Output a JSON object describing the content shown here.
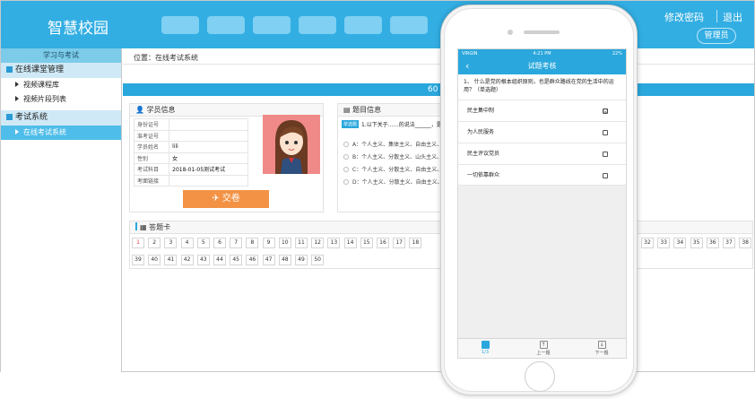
{
  "header": {
    "logo": "智慧校园",
    "change_password": "修改密码",
    "logout": "退出",
    "admin": "管理员"
  },
  "sidebar": {
    "title": "学习与考试",
    "groups": [
      {
        "label": "在线课堂管理",
        "items": [
          {
            "label": "视频课程库"
          },
          {
            "label": "视频片段列表"
          }
        ]
      },
      {
        "label": "考试系统",
        "items": [
          {
            "label": "在线考试系统"
          }
        ]
      }
    ]
  },
  "main": {
    "breadcrumb": "位置：在线考试系统",
    "timer_text": "60 :",
    "student_panel": {
      "title": "学员信息",
      "rows": [
        {
          "label": "身份证号",
          "value": ""
        },
        {
          "label": "准考证号",
          "value": ""
        },
        {
          "label": "学员姓名",
          "value": "lili"
        },
        {
          "label": "性别",
          "value": "女"
        },
        {
          "label": "考试科目",
          "value": "2018-01-05测试考试"
        },
        {
          "label": "考面链接",
          "value": ""
        }
      ],
      "submit_label": "交卷"
    },
    "question_panel": {
      "title": "题目信息",
      "tag": "单选题",
      "question": "1.以下关于……的说法______，是",
      "options": [
        {
          "label": "A：个人主义、集体主义、自由主义、..."
        },
        {
          "label": "B：个人主义、分散主义、山头主义、..."
        },
        {
          "label": "C：个人主义、分散主义、自由主义、..."
        },
        {
          "label": "D：个人主义、分散主义、自由主义、..."
        }
      ]
    },
    "answer_card": {
      "title": "答题卡",
      "row1": [
        "1",
        "2",
        "3",
        "4",
        "5",
        "6",
        "7",
        "8",
        "9",
        "10",
        "11",
        "12",
        "13",
        "14",
        "15",
        "16",
        "17",
        "18"
      ],
      "row1_right": [
        "32",
        "33",
        "34",
        "35",
        "36",
        "37",
        "38"
      ],
      "row2": [
        "39",
        "40",
        "41",
        "42",
        "43",
        "44",
        "45",
        "46",
        "47",
        "48",
        "49",
        "50"
      ]
    }
  },
  "phone": {
    "status": {
      "carrier": "VIRGIN",
      "time": "4:21 PM",
      "battery": "22%"
    },
    "nav_title": "试题考核",
    "back": "‹",
    "question": "1、 什么是党的根本组织原则，也是群众路线在党的生活中的运用？（单选题）",
    "options": [
      {
        "label": "民主集中制",
        "checked": "☑"
      },
      {
        "label": "为人民服务",
        "checked": ""
      },
      {
        "label": "民主评议党员",
        "checked": ""
      },
      {
        "label": "一切依靠群众",
        "checked": ""
      }
    ],
    "tabs": [
      {
        "label": "1/3"
      },
      {
        "label": "上一题"
      },
      {
        "label": "下一题"
      }
    ]
  },
  "colors": {
    "primary": "#32aee3",
    "accent": "#f39245",
    "photo_bg": "#f08a88"
  }
}
